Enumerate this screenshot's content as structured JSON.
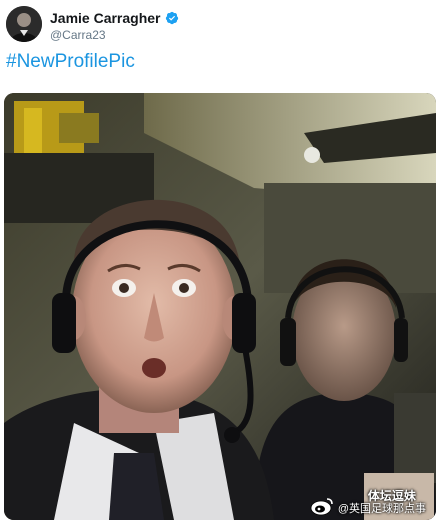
{
  "tweet": {
    "display_name": "Jamie Carragher",
    "handle": "@Carra23",
    "hashtag": "#NewProfilePic"
  },
  "watermark": {
    "title": "体坛逗妹",
    "subtitle": "@英国足球那点事"
  },
  "icons": {
    "verified": "verified-badge-icon",
    "watermark_logo": "weibo-icon"
  },
  "colors": {
    "name": "#14171a",
    "handle": "#657786",
    "hashtag": "#1b95e0",
    "verified": "#1da1f2"
  }
}
